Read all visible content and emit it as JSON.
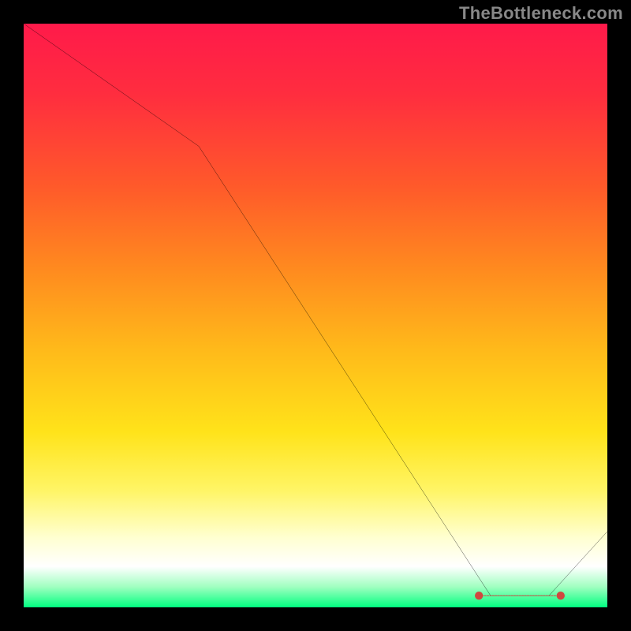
{
  "attribution": "TheBottleneck.com",
  "chart_data": {
    "type": "line",
    "title": "",
    "xlabel": "",
    "ylabel": "",
    "xlim": [
      0,
      100
    ],
    "ylim": [
      0,
      100
    ],
    "x": [
      0,
      30,
      80,
      90,
      100
    ],
    "values": [
      100,
      79,
      2,
      2,
      13
    ],
    "highlight_segment": {
      "x_start": 78,
      "x_end": 92,
      "y": 2
    },
    "gradient_stops": [
      {
        "offset": 0.0,
        "color": "#ff1a4a"
      },
      {
        "offset": 0.12,
        "color": "#ff2d3f"
      },
      {
        "offset": 0.28,
        "color": "#ff5a2a"
      },
      {
        "offset": 0.42,
        "color": "#ff8a1f"
      },
      {
        "offset": 0.56,
        "color": "#ffba1a"
      },
      {
        "offset": 0.7,
        "color": "#ffe31a"
      },
      {
        "offset": 0.8,
        "color": "#fff566"
      },
      {
        "offset": 0.88,
        "color": "#ffffd0"
      },
      {
        "offset": 0.93,
        "color": "#ffffff"
      },
      {
        "offset": 0.965,
        "color": "#a0ffc0"
      },
      {
        "offset": 1.0,
        "color": "#00ff80"
      }
    ]
  }
}
